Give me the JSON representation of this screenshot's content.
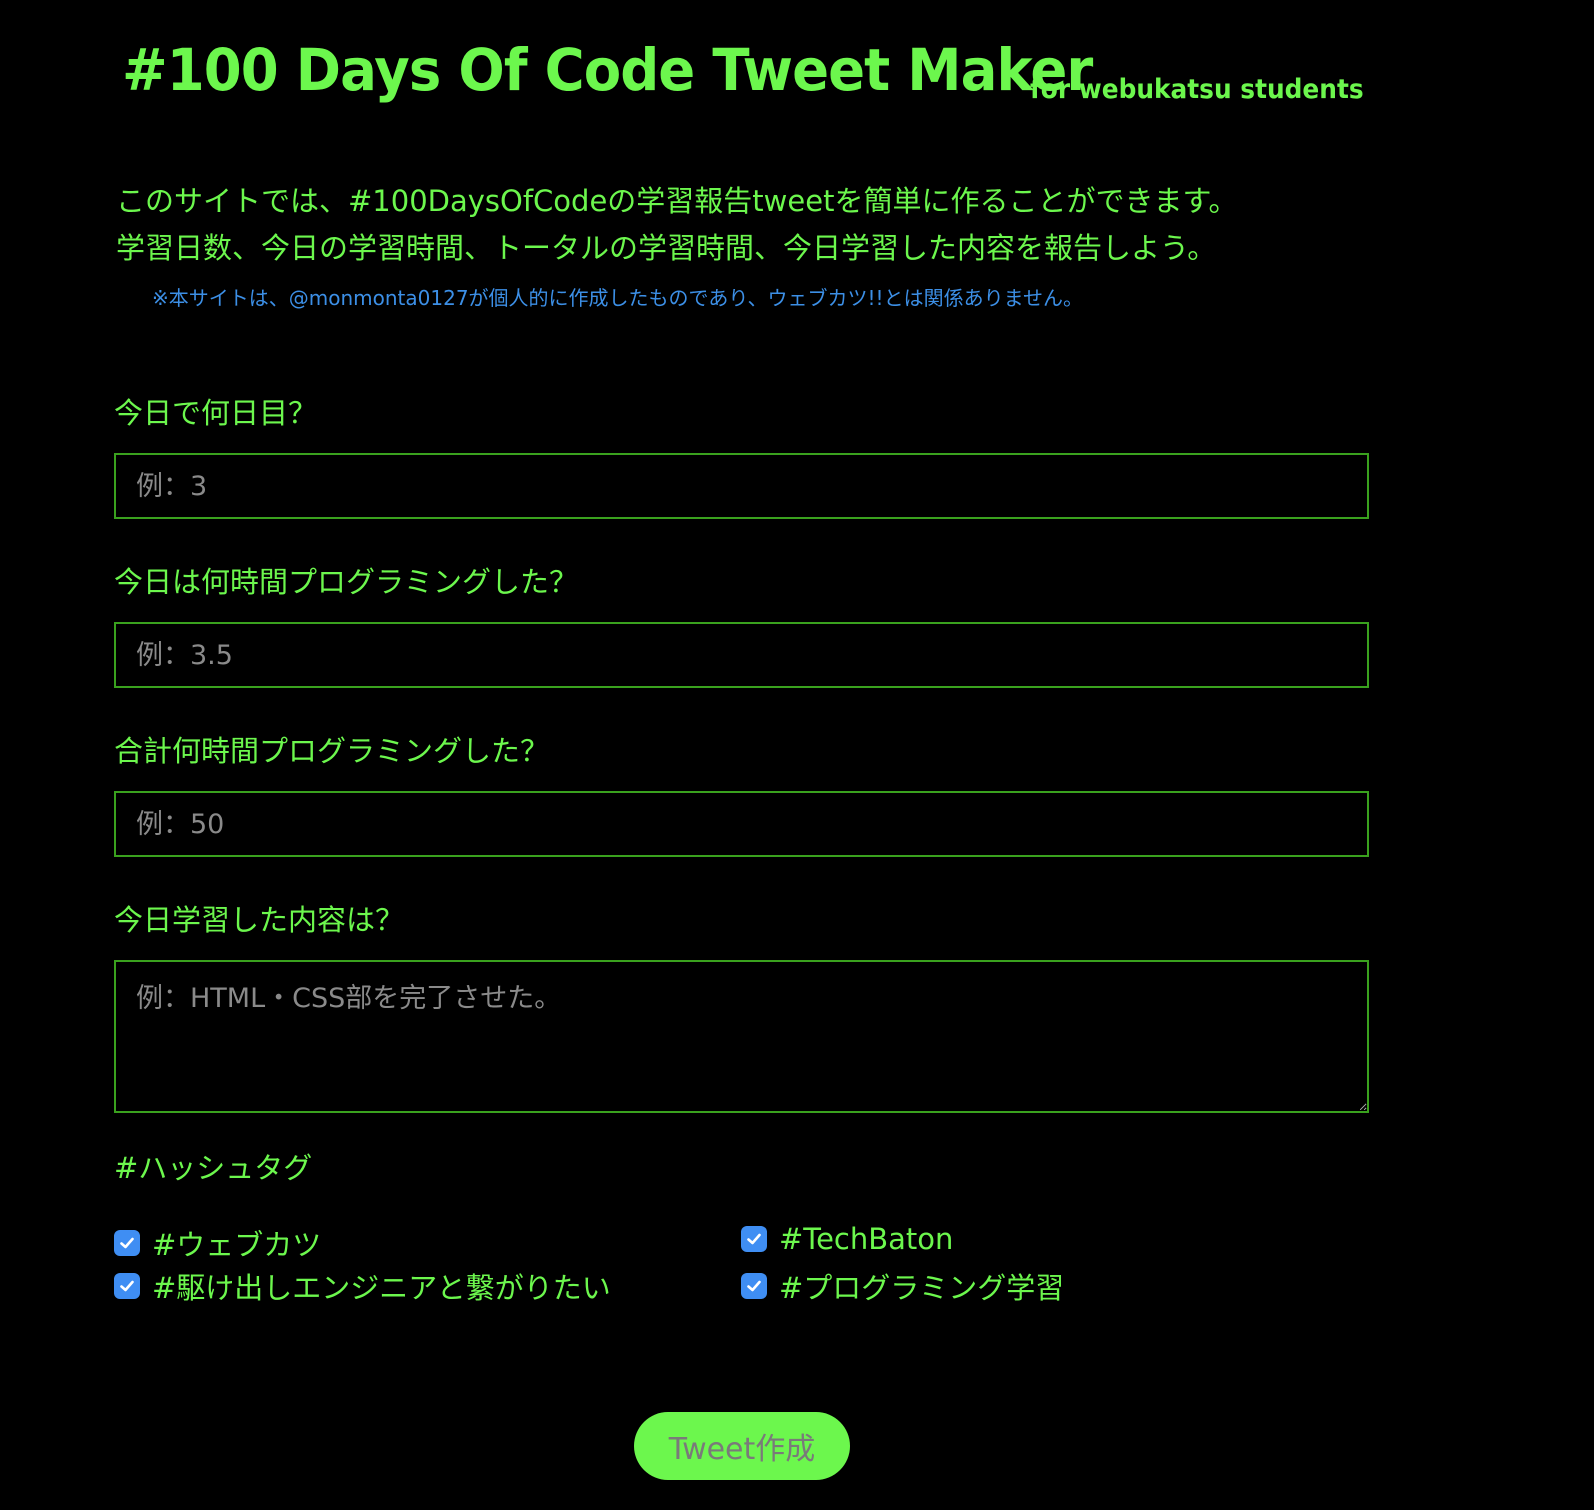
{
  "header": {
    "title": "#100 Days Of Code Tweet Maker",
    "subtitle": "for webukatsu students"
  },
  "intro": {
    "line1": "このサイトでは、#100DaysOfCodeの学習報告tweetを簡単に作ることができます。",
    "line2": "学習日数、今日の学習時間、トータルの学習時間、今日学習した内容を報告しよう。",
    "note": "※本サイトは、@monmonta0127が個人的に作成したものであり、ウェブカツ!!とは関係ありません。"
  },
  "form": {
    "q1_label": "今日で何日目？",
    "q1_placeholder": "例：3",
    "q2_label": "今日は何時間プログラミングした？",
    "q2_placeholder": "例：3.5",
    "q3_label": "合計何時間プログラミングした？",
    "q3_placeholder": "例：50",
    "q4_label": "今日学習した内容は？",
    "q4_placeholder": "例：HTML・CSS部を完了させた。"
  },
  "hashtags": {
    "title": "#ハッシュタグ",
    "items": [
      {
        "label": "#ウェブカツ",
        "checked": true
      },
      {
        "label": "#TechBaton",
        "checked": true
      },
      {
        "label": "#駆け出しエンジニアと繋がりたい",
        "checked": true
      },
      {
        "label": "#プログラミング学習",
        "checked": true
      }
    ]
  },
  "actions": {
    "submit_label": "Tweet作成"
  },
  "colors": {
    "accent": "#6cf74d",
    "border": "#3aa11e",
    "note": "#3c8fe6",
    "checkbox": "#3f8ef3",
    "background": "#000000"
  }
}
